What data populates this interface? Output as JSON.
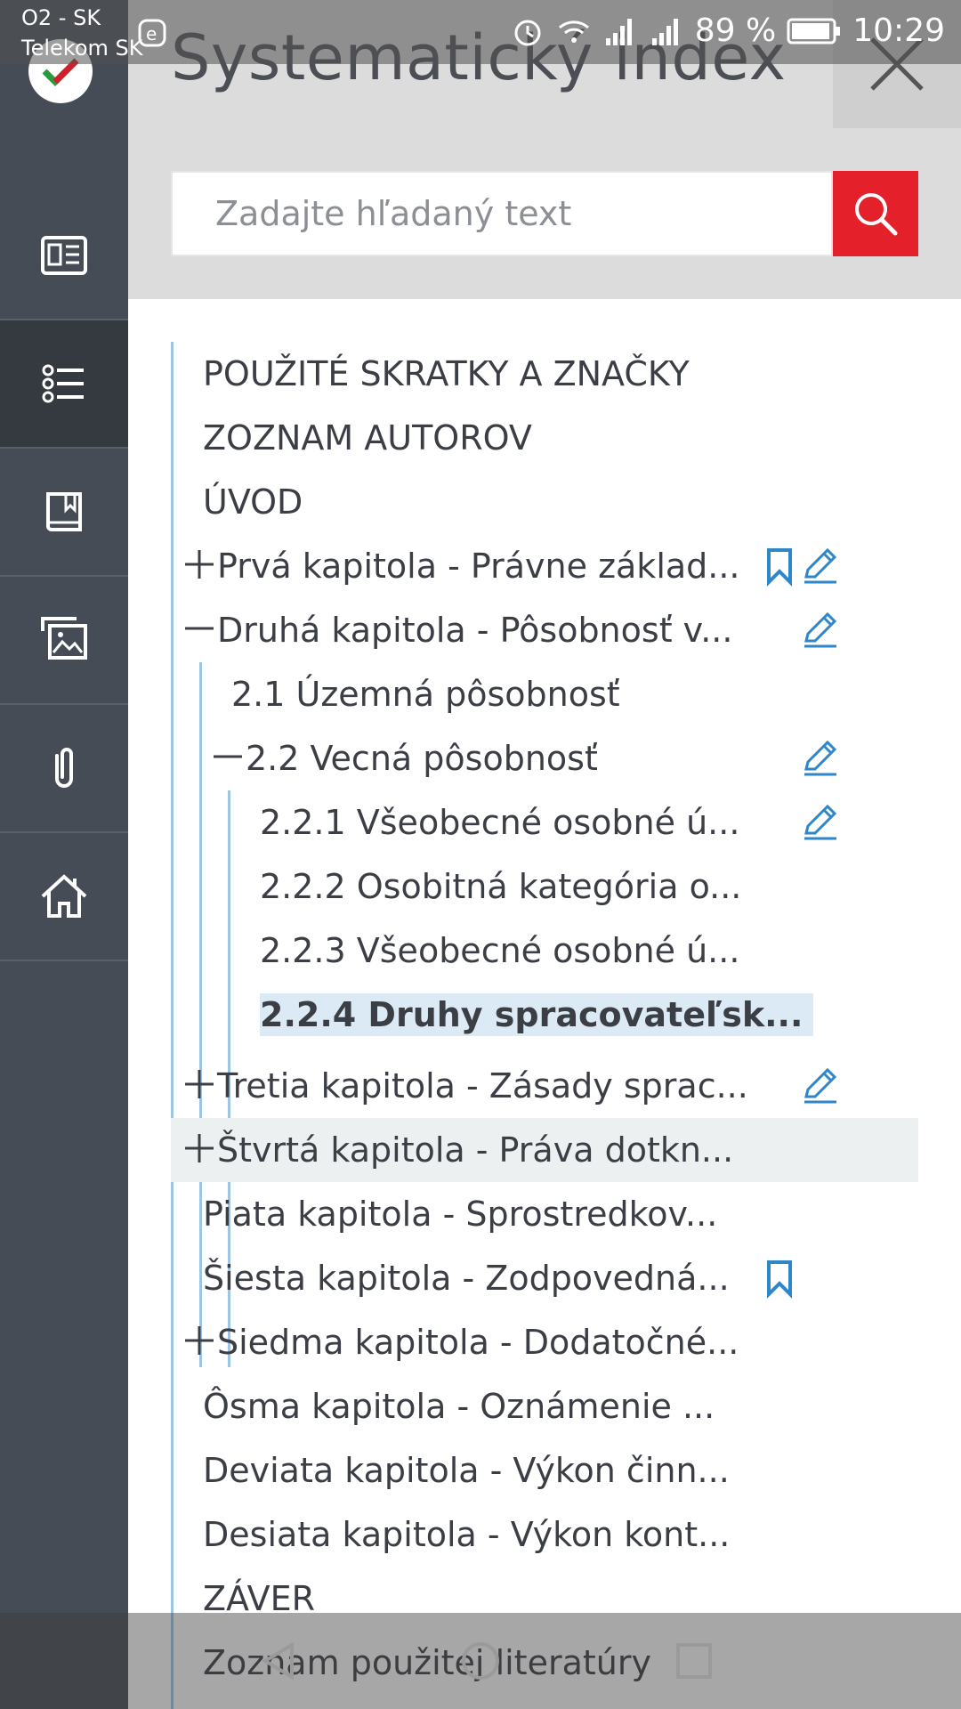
{
  "status_bar": {
    "carrier_line1": "O2 - SK",
    "carrier_line2": "Telekom SK",
    "battery": "89 %",
    "time": "10:29"
  },
  "panel": {
    "title": "Systematický index",
    "search_placeholder": "Zadajte hľadaný text"
  },
  "rail": {
    "items": [
      {
        "icon": "article-icon"
      },
      {
        "icon": "list-icon",
        "active": true
      },
      {
        "icon": "book-bookmark-icon"
      },
      {
        "icon": "gallery-icon"
      },
      {
        "icon": "attachment-icon"
      },
      {
        "icon": "home-icon"
      }
    ]
  },
  "tree": [
    {
      "label": "POUŽITÉ SKRATKY A ZNAČKY",
      "level": 0,
      "sign": "",
      "bookmark": false,
      "edit": false
    },
    {
      "label": "ZOZNAM AUTOROV",
      "level": 0,
      "sign": "",
      "bookmark": false,
      "edit": false
    },
    {
      "label": "ÚVOD",
      "level": 0,
      "sign": "",
      "bookmark": false,
      "edit": false
    },
    {
      "label": "Prvá kapitola - Právne základ...",
      "level": 0,
      "sign": "plus",
      "bookmark": true,
      "edit": true
    },
    {
      "label": "Druhá kapitola - Pôsobnosť v...",
      "level": 0,
      "sign": "minus",
      "bookmark": false,
      "edit": true
    },
    {
      "label": "2.1 Územná pôsobnosť",
      "level": 1,
      "sign": "",
      "bookmark": false,
      "edit": false
    },
    {
      "label": "2.2 Vecná pôsobnosť",
      "level": 1,
      "sign": "minus",
      "bookmark": false,
      "edit": true
    },
    {
      "label": "2.2.1 Všeobecné osobné ú...",
      "level": 2,
      "sign": "",
      "bookmark": false,
      "edit": true
    },
    {
      "label": "2.2.2 Osobitná kategória o...",
      "level": 2,
      "sign": "",
      "bookmark": false,
      "edit": false
    },
    {
      "label": "2.2.3 Všeobecné osobné ú...",
      "level": 2,
      "sign": "",
      "bookmark": false,
      "edit": false
    },
    {
      "label": "2.2.4 Druhy spracovateľsk...",
      "level": 2,
      "sign": "",
      "bookmark": false,
      "edit": false,
      "selected": true
    },
    {
      "label": "Tretia kapitola - Zásady sprac...",
      "level": 0,
      "sign": "plus",
      "bookmark": false,
      "edit": true
    },
    {
      "label": "Štvrtá kapitola - Práva dotkn...",
      "level": 0,
      "sign": "plus",
      "bookmark": false,
      "edit": false,
      "hover": true
    },
    {
      "label": "Piata kapitola - Sprostredkov...",
      "level": 0,
      "sign": "",
      "bookmark": false,
      "edit": false
    },
    {
      "label": "Šiesta kapitola - Zodpovedná...",
      "level": 0,
      "sign": "",
      "bookmark": true,
      "edit": false
    },
    {
      "label": "Siedma kapitola - Dodatočné...",
      "level": 0,
      "sign": "plus",
      "bookmark": false,
      "edit": false
    },
    {
      "label": "Ôsma kapitola - Oznámenie ...",
      "level": 0,
      "sign": "",
      "bookmark": false,
      "edit": false
    },
    {
      "label": "Deviata kapitola - Výkon činn...",
      "level": 0,
      "sign": "",
      "bookmark": false,
      "edit": false
    },
    {
      "label": "Desiata kapitola - Výkon kont...",
      "level": 0,
      "sign": "",
      "bookmark": false,
      "edit": false
    },
    {
      "label": "ZÁVER",
      "level": 0,
      "sign": "",
      "bookmark": false,
      "edit": false
    },
    {
      "label": "Zoznam použitej literatúry",
      "level": 0,
      "sign": "",
      "bookmark": false,
      "edit": false
    }
  ],
  "colors": {
    "rail": "#464c55",
    "rail_active": "#353a41",
    "search_button": "#e4202b",
    "tree_line": "#9ec6e2",
    "icon_blue": "#2f86c8"
  }
}
